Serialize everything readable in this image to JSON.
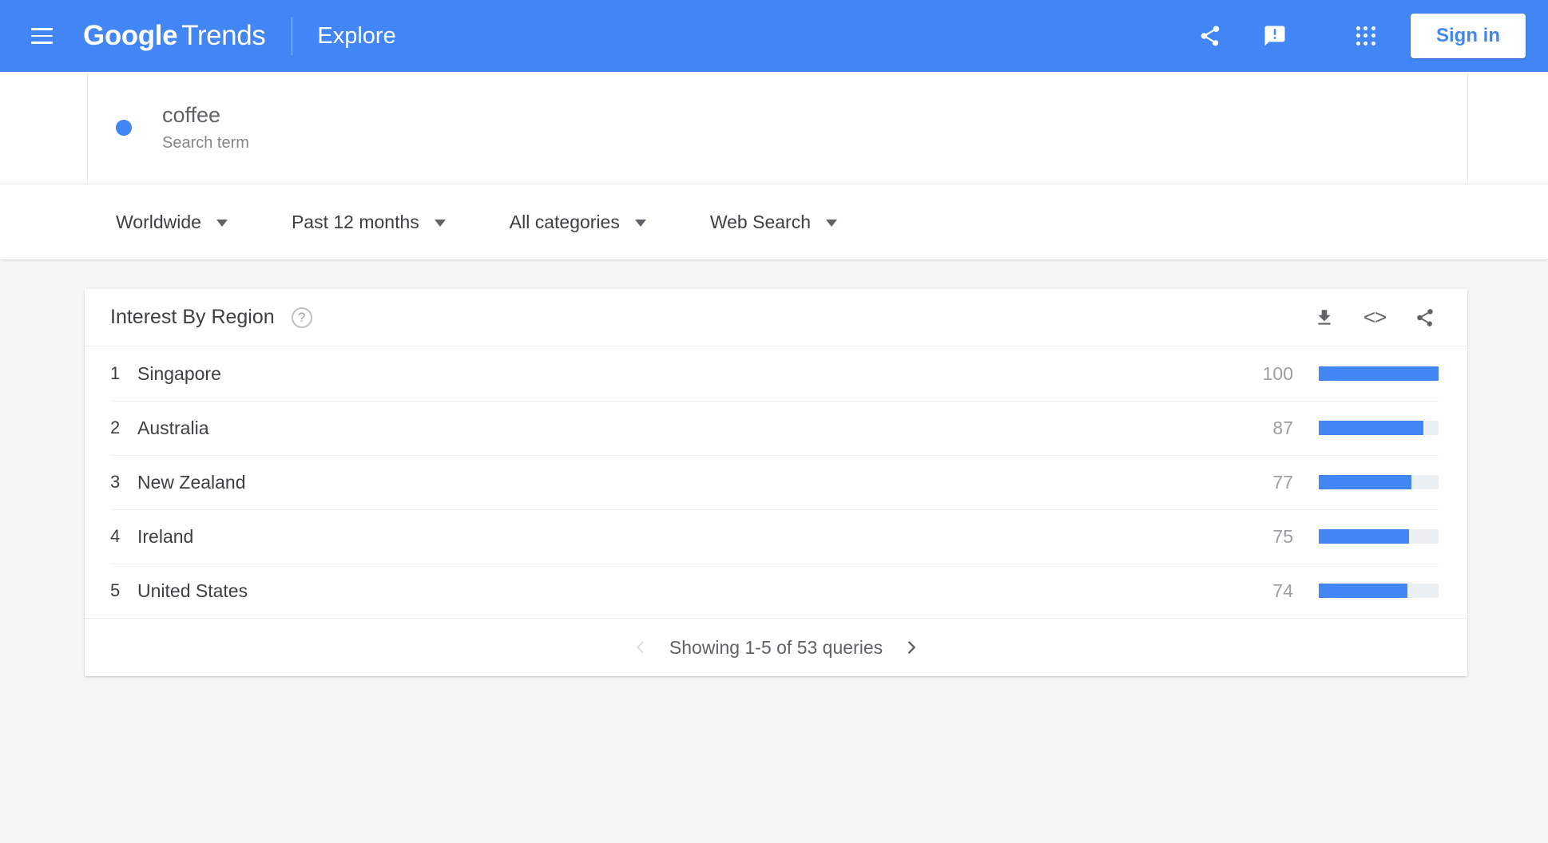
{
  "app_bar": {
    "menu_icon": "hamburger-menu-icon",
    "brand_google": "Google",
    "brand_trends": "Trends",
    "explore": "Explore",
    "share_icon": "share-icon",
    "feedback_icon": "feedback-icon",
    "apps_icon": "apps-grid-icon",
    "sign_in": "Sign in",
    "background_color": "#4285f4"
  },
  "search_term": {
    "dot_color": "#4285f4",
    "title": "coffee",
    "subtitle": "Search term"
  },
  "filters": [
    {
      "label": "Worldwide",
      "name": "location-filter"
    },
    {
      "label": "Past 12 months",
      "name": "time-range-filter"
    },
    {
      "label": "All categories",
      "name": "category-filter"
    },
    {
      "label": "Web Search",
      "name": "search-type-filter"
    }
  ],
  "region_card": {
    "title": "Interest By Region",
    "help_icon_label": "?",
    "download_icon": "download-icon",
    "embed_icon": "<>",
    "share_icon": "share-icon",
    "pagination": {
      "prev_icon": "chevron-left-icon",
      "status": "Showing 1-5 of 53 queries",
      "next_icon": "chevron-right-icon"
    }
  },
  "chart_data": {
    "type": "bar",
    "title": "Interest By Region",
    "subtitle": "coffee — Search term",
    "orientation": "horizontal",
    "categories": [
      "Singapore",
      "Australia",
      "New Zealand",
      "Ireland",
      "United States"
    ],
    "values": [
      100,
      87,
      77,
      75,
      74
    ],
    "ranks": [
      1,
      2,
      3,
      4,
      5
    ],
    "xlabel": "",
    "ylabel": "",
    "ylim": [
      0,
      100
    ],
    "grid": false,
    "legend": false,
    "bar_color": "#4285f4",
    "track_color": "#eceff1",
    "total_queries": 53,
    "showing_range": "1-5"
  }
}
